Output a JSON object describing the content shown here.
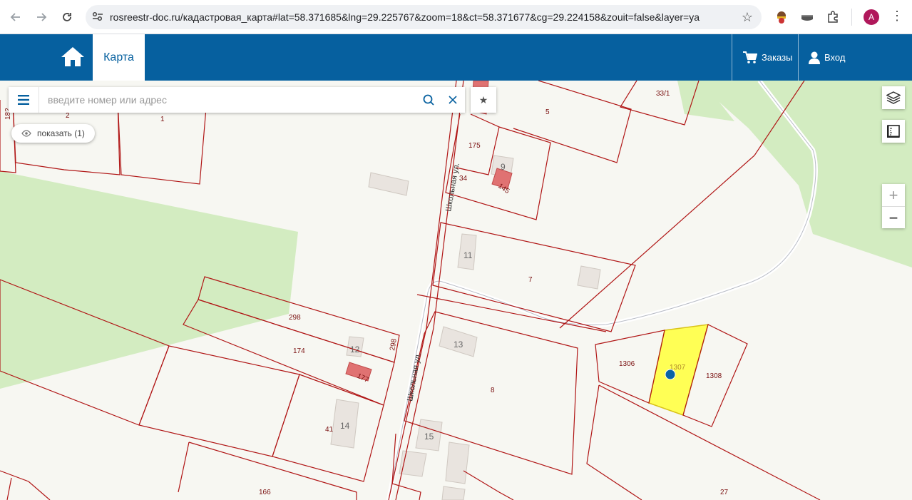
{
  "browser": {
    "url": "rosreestr-doc.ru/кадастровая_карта#lat=58.371685&lng=29.225767&zoom=18&ct=58.371677&cg=29.224158&zouit=false&layer=ya",
    "profile_initial": "A"
  },
  "header": {
    "map_tab": "Карта",
    "orders_label": "Заказы",
    "login_label": "Вход",
    "brand_color": "#06609f"
  },
  "search": {
    "placeholder": "введите номер или адрес",
    "show_label": "показать (1)"
  },
  "zoom": {
    "in_label": "+",
    "out_label": "−"
  },
  "map": {
    "parcel_labels": [
      "182",
      "2",
      "1",
      "5",
      "33/1",
      "175",
      "9",
      "34",
      "145",
      "11",
      "7",
      "298",
      "174",
      "12",
      "177",
      "298",
      "13",
      "8",
      "1306",
      "1307",
      "1308",
      "41",
      "14",
      "15",
      "166",
      "27"
    ],
    "street_labels": [
      "Школьная ул.",
      "Школьная ул."
    ],
    "highlight_color": "#ffff55",
    "boundary_color": "#b01515"
  }
}
